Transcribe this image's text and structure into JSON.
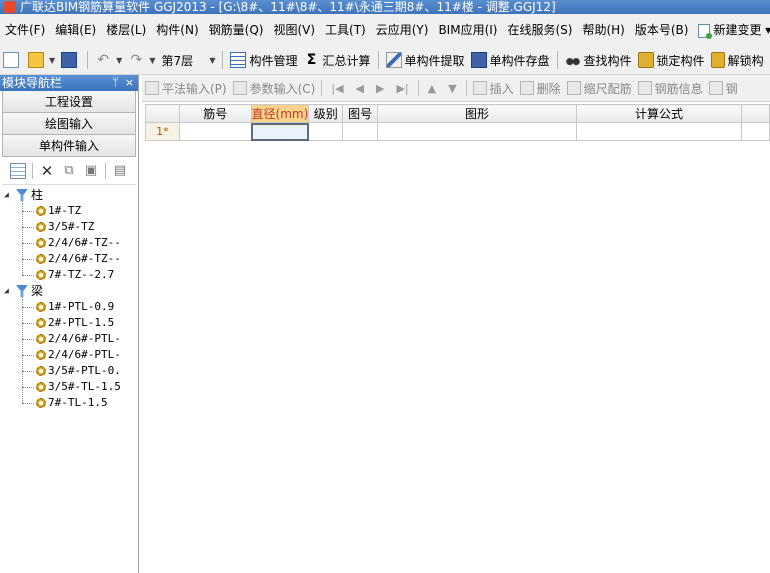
{
  "window": {
    "title": "广联达BIM钢筋算量软件 GGJ2013 - [G:\\8#、11#\\8#、11#\\永通三期8#、11#楼 - 调整.GGJ12]"
  },
  "menu": {
    "items": [
      "文件(F)",
      "编辑(E)",
      "楼层(L)",
      "构件(N)",
      "钢筋量(Q)",
      "视图(V)",
      "工具(T)",
      "云应用(Y)",
      "BIM应用(I)",
      "在线服务(S)",
      "帮助(H)",
      "版本号(B)"
    ],
    "new_change": "新建变更",
    "new_change_arrow": "▾"
  },
  "toolbar": {
    "floor": "第7层",
    "component_manage": "构件管理",
    "sum_calc": "汇总计算",
    "single_extract": "单构件提取",
    "single_save": "单构件存盘",
    "find_component": "查找构件",
    "lock_component": "锁定构件",
    "unlock_component": "解锁构"
  },
  "nav": {
    "title": "模块导航栏",
    "pin": "ᛘ",
    "close": "×",
    "sections": [
      "工程设置",
      "绘图输入",
      "单构件输入"
    ],
    "tree": [
      {
        "label": "柱",
        "expanded": true,
        "children": [
          "1#-TZ",
          "3/5#-TZ",
          "2/4/6#-TZ--",
          "2/4/6#-TZ--",
          "7#-TZ--2.7"
        ]
      },
      {
        "label": "梁",
        "expanded": true,
        "children": [
          "1#-PTL-0.9",
          "2#-PTL-1.5",
          "2/4/6#-PTL-",
          "2/4/6#-PTL-",
          "3/5#-PTL-0.",
          "3/5#-TL-1.5",
          "7#-TL-1.5"
        ]
      }
    ]
  },
  "sub_toolbar": {
    "plane_input": "平法输入(P)",
    "param_input": "参数输入(C)",
    "insert": "插入",
    "delete": "删除",
    "scale_rebar": "缩尺配筋",
    "rebar_info": "钢筋信息",
    "rebar_more": "钢"
  },
  "grid": {
    "columns": [
      "筋号",
      "直径(mm)",
      "级别",
      "图号",
      "图形",
      "计算公式"
    ],
    "highlight_column": "直径(mm)",
    "rows": [
      {
        "row_label": "1*",
        "cells": [
          "",
          "",
          "",
          "",
          "",
          ""
        ]
      }
    ]
  }
}
